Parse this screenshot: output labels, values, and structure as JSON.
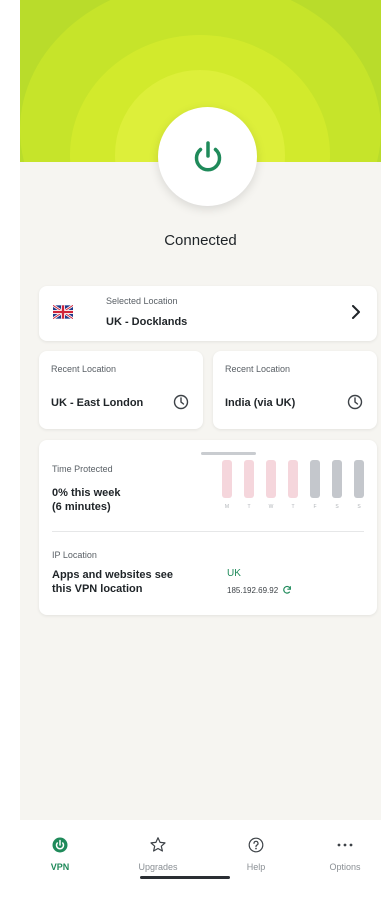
{
  "status": "Connected",
  "selected_location": {
    "label": "Selected Location",
    "value": "UK - Docklands",
    "flag": "uk-flag-icon"
  },
  "recent_locations": [
    {
      "label": "Recent Location",
      "value": "UK - East London"
    },
    {
      "label": "Recent Location",
      "value": "India (via UK)"
    }
  ],
  "time_protected": {
    "label": "Time Protected",
    "line1": "0% this week",
    "line2": "(6 minutes)",
    "days": [
      "M",
      "T",
      "W",
      "T",
      "F",
      "S",
      "S"
    ]
  },
  "ip_location": {
    "label": "IP Location",
    "line1": "Apps and websites see",
    "line2": "this VPN location",
    "country": "UK",
    "address": "185.192.69.92"
  },
  "nav": [
    {
      "label": "VPN",
      "icon": "vpn-icon"
    },
    {
      "label": "Upgrades",
      "icon": "star-icon"
    },
    {
      "label": "Help",
      "icon": "help-icon"
    },
    {
      "label": "Options",
      "icon": "more-icon"
    }
  ],
  "colors": {
    "accent": "#1f8a5a",
    "hero_green": "#c6e42a",
    "bar_pink": "#f5d6dc",
    "bar_gray": "#c4c7cc"
  }
}
